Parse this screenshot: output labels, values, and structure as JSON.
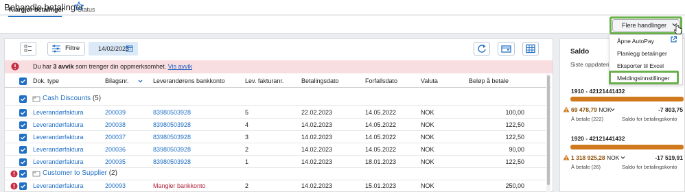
{
  "header": {
    "title": "Behandle betalinger"
  },
  "tabs": [
    {
      "label": "Klargjør betalinger",
      "active": true
    },
    {
      "label": "Status",
      "active": false
    }
  ],
  "actions": {
    "more_label": "Flere handlinger"
  },
  "menu": {
    "items": [
      "Åpne AutoPay",
      "Planlegg betalinger",
      "Eksporter til Excel",
      "Meldingsinnstillinger"
    ]
  },
  "toolbar": {
    "filter_label": "Filtre",
    "date_value": "14/02/2023"
  },
  "alert": {
    "prefix": "Du har",
    "count": "3 avvik",
    "suffix": "som trenger din oppmerksomhet.",
    "link": "Vis avvik"
  },
  "table": {
    "columns": [
      "Dok. type",
      "Bilagsnr.",
      "Leverandørens bankkonto",
      "Lev. fakturanr.",
      "Betalingsdato",
      "Forfallsdato",
      "Valuta",
      "Beløp å betale"
    ],
    "groups": [
      {
        "name": "Cash Discounts",
        "count": "(5)",
        "rows": [
          {
            "type": "Leverandørfaktura",
            "bilag": "200039",
            "konto": "83980503928",
            "faktura": "5",
            "betdato": "22.02.2023",
            "forfall": "14.05.2022",
            "valuta": "NOK",
            "belop": "100,00"
          },
          {
            "type": "Leverandørfaktura",
            "bilag": "200038",
            "konto": "83980503928",
            "faktura": "4",
            "betdato": "14.02.2023",
            "forfall": "14.05.2022",
            "valuta": "NOK",
            "belop": "122,50"
          },
          {
            "type": "Leverandørfaktura",
            "bilag": "200037",
            "konto": "83980503928",
            "faktura": "3",
            "betdato": "14.02.2023",
            "forfall": "14.05.2022",
            "valuta": "NOK",
            "belop": "122,50"
          },
          {
            "type": "Leverandørfaktura",
            "bilag": "200036",
            "konto": "83980503928",
            "faktura": "2",
            "betdato": "14.02.2023",
            "forfall": "14.05.2022",
            "valuta": "NOK",
            "belop": "90,00"
          },
          {
            "type": "Leverandørfaktura",
            "bilag": "200035",
            "konto": "83980503928",
            "faktura": "1",
            "betdato": "14.02.2023",
            "forfall": "18.01.2023",
            "valuta": "NOK",
            "belop": "122,50"
          }
        ]
      },
      {
        "name": "Customer to Supplier",
        "count": "(2)",
        "rows": [
          {
            "type": "Leverandørfaktura",
            "bilag": "200093",
            "konto": "Mangler bankkonto",
            "faktura": "2",
            "betdato": "14.02.2023",
            "forfall": "15.01.2023",
            "valuta": "NOK",
            "belop": "250,00"
          }
        ]
      }
    ]
  },
  "saldo": {
    "title": "Saldo",
    "subtitle": "Siste oppdateri",
    "accounts": [
      {
        "account": "1910 - 42121441432",
        "to_pay": "69 478,79",
        "currency": "NOK",
        "to_pay_label": "Å betale (222)",
        "balance": "-7 803,75",
        "balance_label": "Saldo for betalingskonto"
      },
      {
        "account": "1920 - 42121441432",
        "to_pay": "1 318 925,28",
        "currency": "NOK",
        "to_pay_label": "Å betale (26)",
        "balance": "-17 519,91",
        "balance_label": "Saldo for betalingskonto"
      }
    ]
  },
  "colors": {
    "accent": "#1f6fc5",
    "highlight": "#6ab04c",
    "alert_bg": "#f8dde1",
    "bar": "#d17a1d",
    "error": "#c62f43"
  }
}
